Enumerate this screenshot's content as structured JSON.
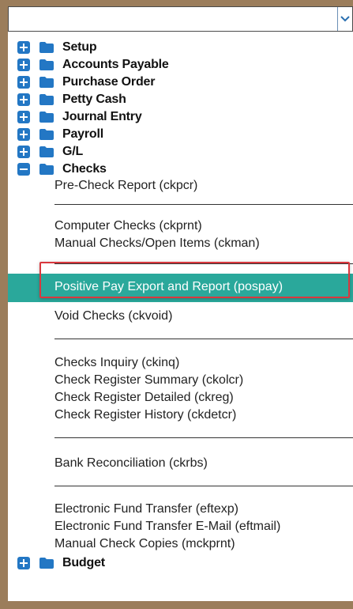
{
  "tree": {
    "nodes_top": [
      {
        "label": "Setup",
        "state": "collapsed"
      },
      {
        "label": "Accounts Payable",
        "state": "collapsed"
      },
      {
        "label": "Purchase Order",
        "state": "collapsed"
      },
      {
        "label": "Petty Cash",
        "state": "collapsed"
      },
      {
        "label": "Journal Entry",
        "state": "collapsed"
      },
      {
        "label": "Payroll",
        "state": "collapsed"
      },
      {
        "label": "G/L",
        "state": "collapsed"
      },
      {
        "label": "Checks",
        "state": "expanded"
      }
    ],
    "checks_items": [
      "Pre-Check Report (ckpcr)",
      "Computer Checks (ckprnt)",
      "Manual Checks/Open Items (ckman)",
      "Positive Pay Export and Report (pospay)",
      "Void Checks (ckvoid)",
      "Checks Inquiry (ckinq)",
      "Check Register Summary (ckolcr)",
      "Check Register Detailed (ckreg)",
      "Check Register History (ckdetcr)",
      "Bank Reconciliation (ckrbs)",
      "Electronic Fund Transfer (eftexp)",
      "Electronic Fund Transfer E-Mail (eftmail)",
      "Manual Check Copies (mckprnt)"
    ],
    "node_bottom": {
      "label": "Budget",
      "state": "collapsed"
    }
  },
  "colors": {
    "frame": "#9b7d5b",
    "expand_box": "#2377c4",
    "folder": "#2377c4",
    "selected_row": "#2aa89b",
    "annotation_box": "#d9383e"
  },
  "selected_item": "Positive Pay Export and Report (pospay)"
}
